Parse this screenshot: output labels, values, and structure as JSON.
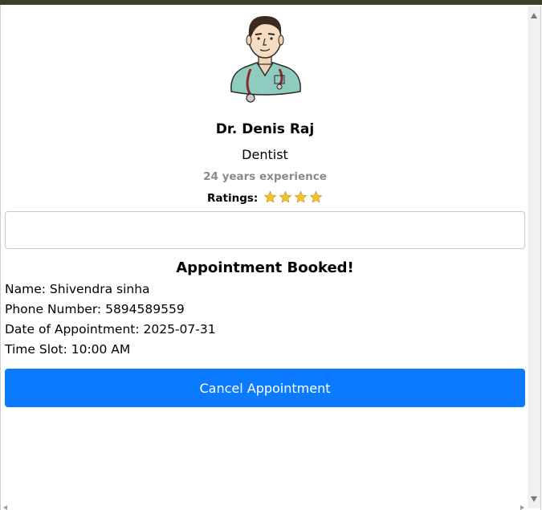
{
  "doctor": {
    "name": "Dr. Denis Raj",
    "specialty": "Dentist",
    "experience": "24 years experience",
    "ratings_label": "Ratings:",
    "rating_stars": 4,
    "avatar_icon": "doctor-avatar-icon"
  },
  "booking": {
    "title": "Appointment Booked!",
    "name_line": "Name: Shivendra sinha",
    "phone_line": "Phone Number: 5894589559",
    "date_line": "Date of Appointment: 2025-07-31",
    "time_line": "Time Slot: 10:00 AM",
    "cancel_label": "Cancel Appointment"
  },
  "colors": {
    "accent": "#0a7bff",
    "star": "#f2c230",
    "muted": "#8a8a8a"
  }
}
